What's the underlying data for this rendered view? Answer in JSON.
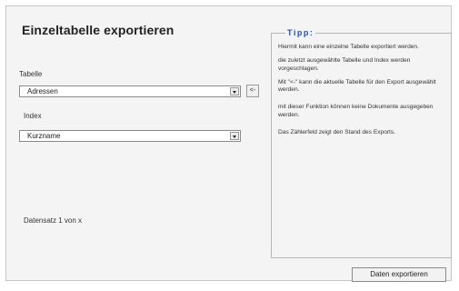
{
  "dialog": {
    "title": "Einzeltabelle exportieren"
  },
  "form": {
    "table_label": "Tabelle",
    "table_value": "Adressen",
    "back_button_label": "<-",
    "index_label": "Index",
    "index_value": "Kurzname",
    "record_counter": "Datensatz 1 von x"
  },
  "tip": {
    "heading": "Tipp:",
    "lines": [
      "Hiermit kann eine einzelne Tabelle exportiert werden.",
      "die zuletzt ausgewählte Tabelle und Index werden vorgeschlagen.",
      "Mit \"<-\" kann die aktuelle Tabelle für den Export ausgewählt werden.",
      "mit dieser Funktion können keine Dokumente ausgegeben werden.",
      "Das Zählerfeld zeigt den Stand des Exports."
    ]
  },
  "actions": {
    "export_label": "Daten exportieren"
  }
}
